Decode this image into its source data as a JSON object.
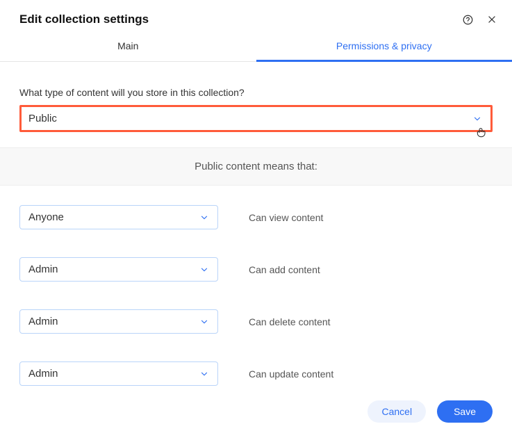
{
  "header": {
    "title": "Edit collection settings"
  },
  "tabs": {
    "main": "Main",
    "permissions": "Permissions & privacy"
  },
  "content_type": {
    "question": "What type of content will you store in this collection?",
    "value": "Public"
  },
  "info_band": "Public content means that:",
  "permissions": [
    {
      "role": "Anyone",
      "label": "Can view content"
    },
    {
      "role": "Admin",
      "label": "Can add content"
    },
    {
      "role": "Admin",
      "label": "Can delete content"
    },
    {
      "role": "Admin",
      "label": "Can update content"
    }
  ],
  "footer": {
    "cancel": "Cancel",
    "save": "Save"
  }
}
